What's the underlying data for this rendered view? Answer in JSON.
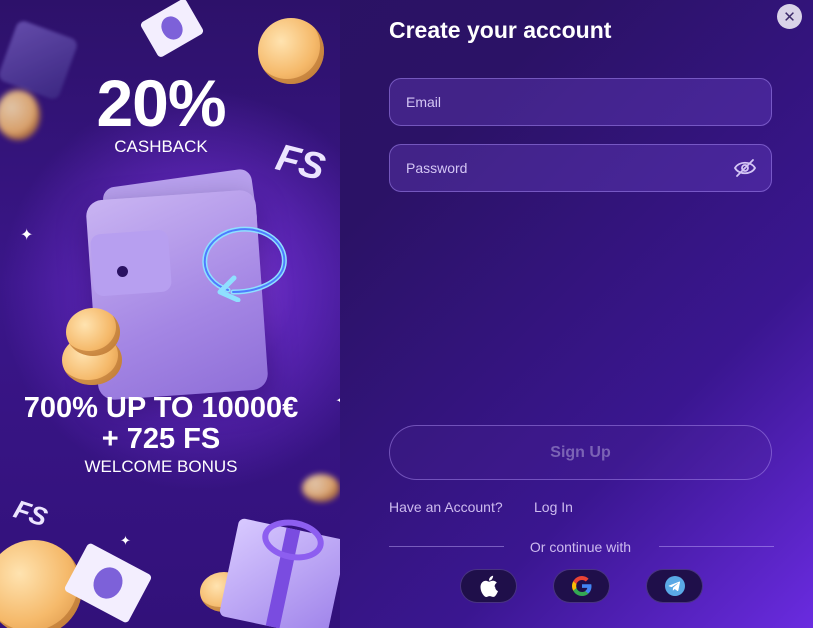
{
  "promo": {
    "percent": "20%",
    "cashback": "CASHBACK",
    "bonus_line1": "700% UP TO 10000€",
    "bonus_line2": "+ 725 FS",
    "welcome": "WELCOME BONUS",
    "fs_badge": "FS"
  },
  "form": {
    "title": "Create your account",
    "email_placeholder": "Email",
    "password_placeholder": "Password",
    "signup_label": "Sign Up",
    "have_account": "Have an Account?",
    "login_label": "Log In",
    "continue_with": "Or continue with"
  },
  "social": [
    {
      "name": "apple-icon"
    },
    {
      "name": "google-icon"
    },
    {
      "name": "telegram-icon"
    }
  ],
  "close_icon": "close-icon",
  "colors": {
    "background": "#2b1266",
    "accent": "#7a3ff0",
    "field_border": "#8f70d8"
  }
}
